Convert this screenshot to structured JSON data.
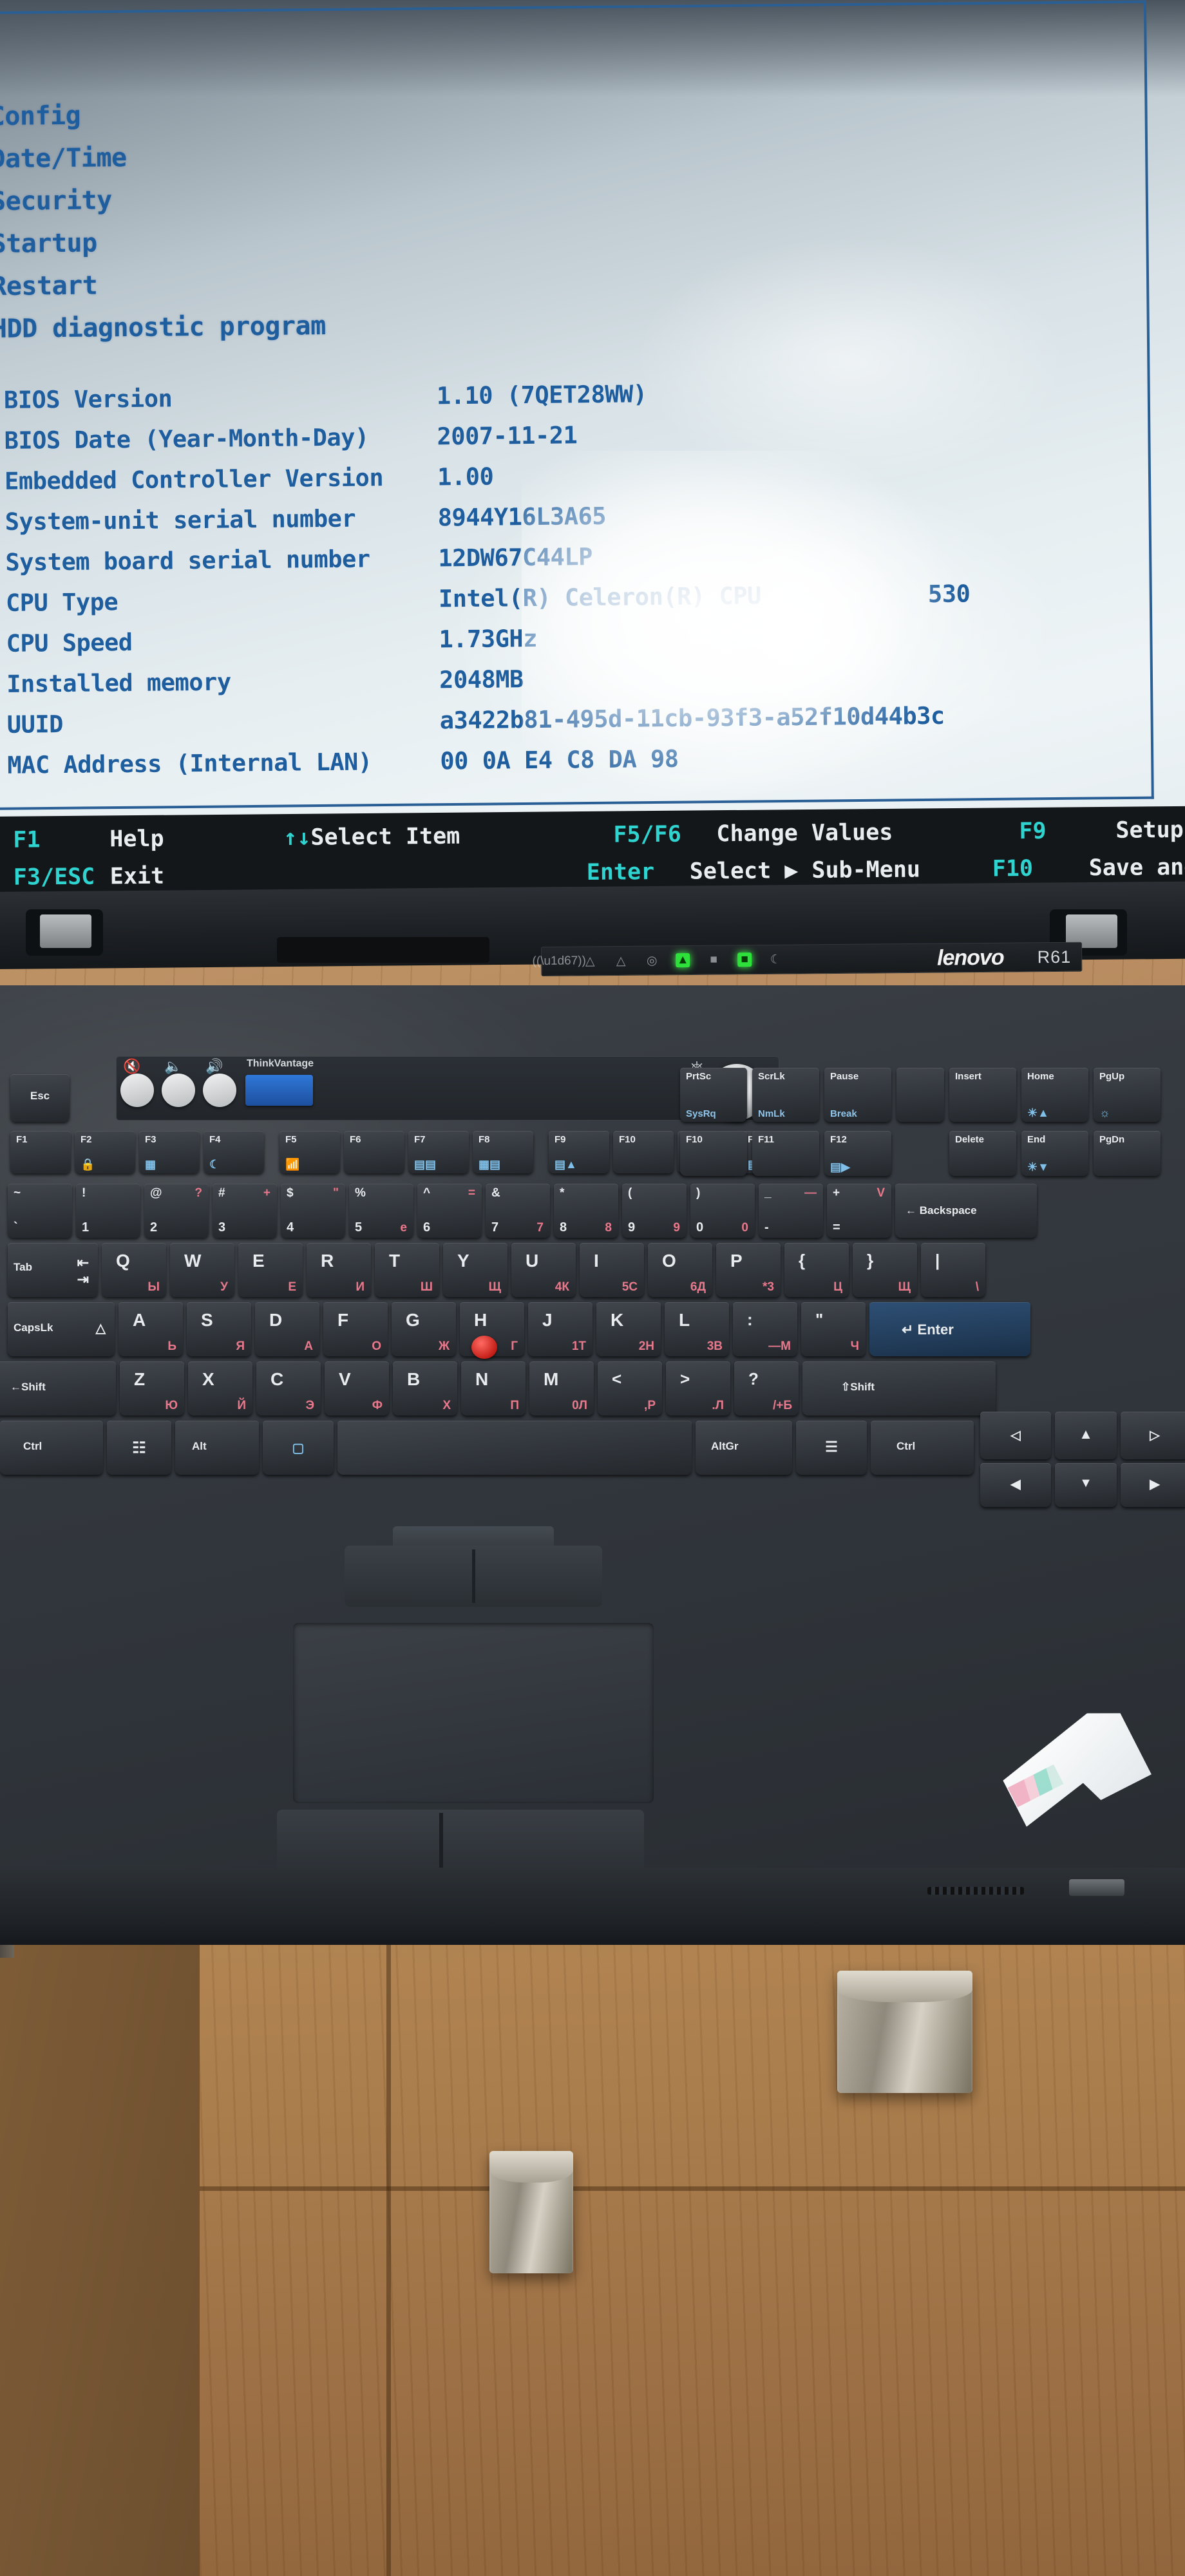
{
  "bios": {
    "menu_items": [
      "Config",
      "Date/Time",
      "Security",
      "Startup",
      "Restart",
      "HDD diagnostic program"
    ],
    "rows": [
      {
        "key": "BIOS Version",
        "value": "1.10   (7QET28WW)",
        "extra": ""
      },
      {
        "key": "BIOS Date (Year-Month-Day)",
        "value": "2007-11-21",
        "extra": ""
      },
      {
        "key": "Embedded Controller Version",
        "value": "1.00",
        "extra": ""
      },
      {
        "key": "System-unit serial number",
        "value": "8944Y16L3A65",
        "extra": ""
      },
      {
        "key": " System board serial number",
        "value": "12DW67C44LP",
        "extra": ""
      },
      {
        "key": " CPU Type",
        "value": "Intel(R) Celeron(R) CPU",
        "extra": "530"
      },
      {
        "key": " CPU Speed",
        "value": "1.73GHz",
        "extra": ""
      },
      {
        "key": " Installed memory",
        "value": "2048MB",
        "extra": ""
      },
      {
        "key": " UUID",
        "value": "a3422b81-495d-11cb-93f3-a52f10d44b3c",
        "extra": ""
      },
      {
        "key": " MAC Address (Internal LAN)",
        "value": "00 0A E4 C8 DA 98",
        "extra": ""
      }
    ],
    "footer": {
      "line1": [
        {
          "key": "F1",
          "label": "Help"
        },
        {
          "key": "↑↓",
          "label": "Select Item"
        },
        {
          "key": "F5/F6",
          "label": "Change Values"
        },
        {
          "key": "F9",
          "label": "Setup Defaults"
        }
      ],
      "line2": [
        {
          "key": "F3/ESC",
          "label": "Exit"
        },
        {
          "key": "",
          "label": ""
        },
        {
          "key": "Enter",
          "label": "Select ▶ Sub-Menu"
        },
        {
          "key": "F10",
          "label": "Save and Exit"
        }
      ]
    },
    "colors": {
      "text": "#1f5e9e",
      "footer_key": "#2fd3cf",
      "footer_label": "#e8eef0",
      "footer_bg": "#14171a"
    }
  },
  "bezel": {
    "brand": "lenovo",
    "model": "R61",
    "indicators": [
      "wireless-icon",
      "bluetooth-icon",
      "bluetooth2-icon",
      "drive-icon",
      "power-led",
      "battery-icon",
      "battery2-led",
      "sleep-icon"
    ]
  },
  "function_bar": {
    "buttons": [
      "mute-button",
      "volume-down-button",
      "volume-up-button"
    ],
    "thinkvantage_label": "ThinkVantage",
    "power_label": "power-button"
  },
  "keyboard": {
    "esc": "Esc",
    "fn_row": [
      {
        "label": "F1",
        "sub": ""
      },
      {
        "label": "F2",
        "sub": "lock-icon"
      },
      {
        "label": "F3",
        "sub": "battery-icon"
      },
      {
        "label": "F4",
        "sub": "sleep-icon"
      },
      {
        "label": "F5",
        "sub": "wireless-icon"
      },
      {
        "label": "F6",
        "sub": ""
      },
      {
        "label": "F7",
        "sub": "display-switch-icon"
      },
      {
        "label": "F8",
        "sub": "screen-expand-icon"
      },
      {
        "label": "F9",
        "sub": "eject-icon"
      },
      {
        "label": "F10",
        "sub": ""
      },
      {
        "label": "F11",
        "sub": ""
      },
      {
        "label": "F12",
        "sub": "hibernate-icon"
      }
    ],
    "nav_top": [
      {
        "label": "PrtSc",
        "sub": "SysRq"
      },
      {
        "label": "ScrLk",
        "sub": "NmLk"
      },
      {
        "label": "Pause",
        "sub": "Break"
      },
      {
        "label": "Insert",
        "sub": ""
      },
      {
        "label": "Home",
        "sub": "brightness-up-icon"
      },
      {
        "label": "PgUp",
        "sub": "backlight-icon"
      }
    ],
    "nav_bottom": [
      {
        "label": "Delete",
        "sub": ""
      },
      {
        "label": "End",
        "sub": "brightness-down-icon"
      },
      {
        "label": "PgDn",
        "sub": ""
      }
    ],
    "number_row": [
      {
        "top": "~",
        "bot": "`",
        "cyr": ""
      },
      {
        "top": "!",
        "bot": "1",
        "cyr": ""
      },
      {
        "top": "@",
        "bot": "2",
        "cyr": "?"
      },
      {
        "top": "#",
        "bot": "3",
        "cyr": "+"
      },
      {
        "top": "$",
        "bot": "4",
        "cyr": "\""
      },
      {
        "top": "%",
        "bot": "5",
        "cyr": "е"
      },
      {
        "top": "^",
        "bot": "6",
        "cyr": "="
      },
      {
        "top": "&",
        "bot": "7",
        "cyr": "7"
      },
      {
        "top": "*",
        "bot": "8",
        "cyr": "8"
      },
      {
        "top": "(",
        "bot": "9",
        "cyr": "9"
      },
      {
        "top": ")",
        "bot": "0",
        "cyr": "0"
      },
      {
        "top": "_",
        "bot": "-",
        "cyr": "—"
      },
      {
        "top": "+",
        "bot": "=",
        "cyr": "V"
      }
    ],
    "backspace": "← Backspace",
    "tab": "Tab",
    "row_q": [
      {
        "lat": "Q",
        "cyr": "Ы"
      },
      {
        "lat": "W",
        "cyr": "У"
      },
      {
        "lat": "E",
        "cyr": "Е"
      },
      {
        "lat": "R",
        "cyr": "И"
      },
      {
        "lat": "T",
        "cyr": "Ш"
      },
      {
        "lat": "Y",
        "cyr": "Щ"
      },
      {
        "lat": "U",
        "cyr": "4К"
      },
      {
        "lat": "I",
        "cyr": "5С"
      },
      {
        "lat": "O",
        "cyr": "6Д"
      },
      {
        "lat": "P",
        "cyr": "*3"
      },
      {
        "lat": "{",
        "cyr": "Ц"
      },
      {
        "lat": "}",
        "cyr": "Щ"
      },
      {
        "lat": "|",
        "cyr": "\\"
      }
    ],
    "capslk": "CapsLk",
    "row_a": [
      {
        "lat": "A",
        "cyr": "Ь"
      },
      {
        "lat": "S",
        "cyr": "Я"
      },
      {
        "lat": "D",
        "cyr": "А"
      },
      {
        "lat": "F",
        "cyr": "О"
      },
      {
        "lat": "G",
        "cyr": "Ж"
      },
      {
        "lat": "H",
        "cyr": "Г"
      },
      {
        "lat": "J",
        "cyr": "1Т"
      },
      {
        "lat": "K",
        "cyr": "2Н"
      },
      {
        "lat": "L",
        "cyr": "3В"
      },
      {
        "lat": ":",
        "cyr": "—М"
      },
      {
        "lat": "\"",
        "cyr": "Ч"
      }
    ],
    "enter": "↵ Enter",
    "shift_left": "←Shift",
    "row_z": [
      {
        "lat": "Z",
        "cyr": "Ю"
      },
      {
        "lat": "X",
        "cyr": "Й"
      },
      {
        "lat": "C",
        "cyr": "Э"
      },
      {
        "lat": "V",
        "cyr": "Ф"
      },
      {
        "lat": "B",
        "cyr": "Х"
      },
      {
        "lat": "N",
        "cyr": "П"
      },
      {
        "lat": "M",
        "cyr": "0Л"
      },
      {
        "lat": "<",
        "cyr": ",Р"
      },
      {
        "lat": ">",
        "cyr": ".Л"
      },
      {
        "lat": "?",
        "cyr": "/+Б"
      }
    ],
    "shift_right": "⇧Shift",
    "bottom_row": [
      {
        "label": "Ctrl"
      },
      {
        "label": "win-icon"
      },
      {
        "label": "Alt"
      },
      {
        "label": "space"
      },
      {
        "label": "AltGr"
      },
      {
        "label": "menu-icon"
      },
      {
        "label": "Ctrl"
      }
    ],
    "arrow_cluster": [
      "back-icon",
      "up-arrow",
      "forward-icon",
      "left-arrow",
      "down-arrow",
      "right-arrow"
    ]
  },
  "desk": {
    "sd_card": "sd-card",
    "knobs": [
      "cabinet-knob-right",
      "cabinet-knob-left"
    ]
  }
}
